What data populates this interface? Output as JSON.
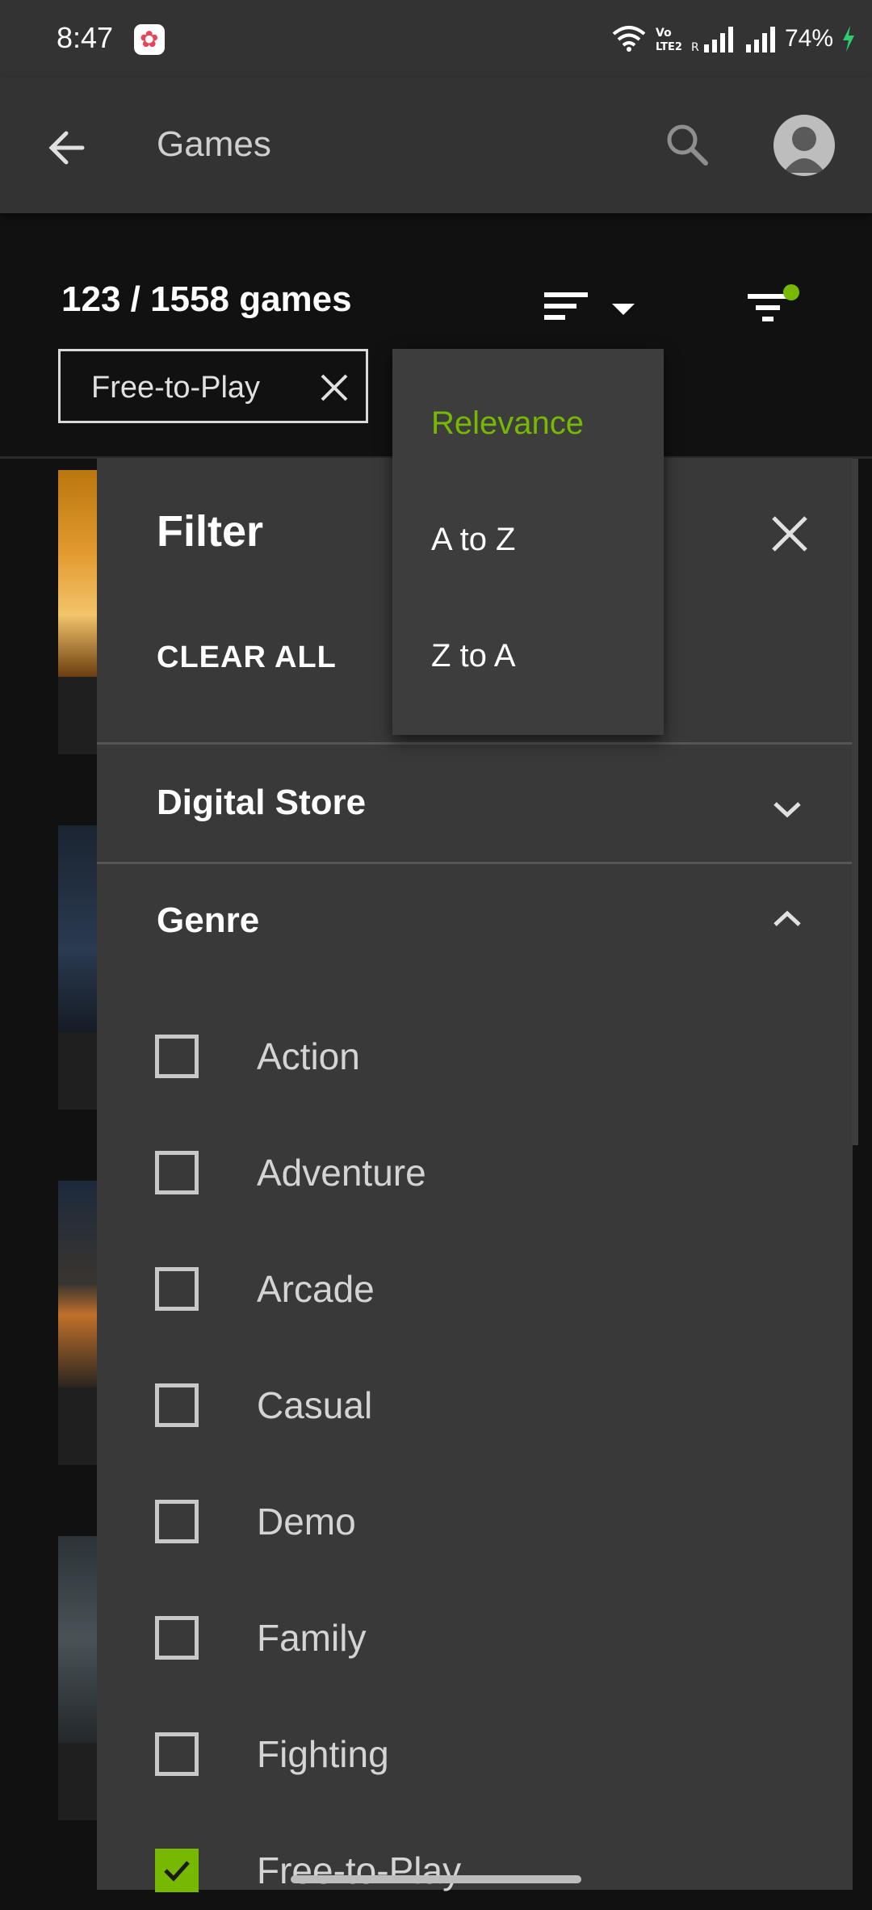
{
  "status_bar": {
    "time": "8:47",
    "battery": "74%",
    "icons": [
      "wifi-icon",
      "volte-icon",
      "signal-icon",
      "signal-icon",
      "charging-icon"
    ]
  },
  "app_bar": {
    "title": "Games",
    "icons": [
      "back-arrow-icon",
      "search-icon",
      "avatar-icon"
    ]
  },
  "games_count": "123 / 1558 games",
  "active_filter_chip": {
    "label": "Free-to-Play"
  },
  "sort_menu": {
    "items": [
      {
        "label": "Relevance",
        "selected": true
      },
      {
        "label": "A to Z",
        "selected": false
      },
      {
        "label": "Z to A",
        "selected": false
      }
    ]
  },
  "filter_panel": {
    "title": "Filter",
    "clear_all": "CLEAR ALL",
    "sections": [
      {
        "title": "Digital Store",
        "expanded": false
      },
      {
        "title": "Genre",
        "expanded": true
      }
    ],
    "genre_options": [
      {
        "label": "Action",
        "checked": false
      },
      {
        "label": "Adventure",
        "checked": false
      },
      {
        "label": "Arcade",
        "checked": false
      },
      {
        "label": "Casual",
        "checked": false
      },
      {
        "label": "Demo",
        "checked": false
      },
      {
        "label": "Family",
        "checked": false
      },
      {
        "label": "Fighting",
        "checked": false
      },
      {
        "label": "Free-to-Play",
        "checked": true
      }
    ]
  },
  "colors": {
    "accent": "#76b900",
    "panel": "#393939",
    "app_bar": "#333333",
    "background": "#111111"
  }
}
